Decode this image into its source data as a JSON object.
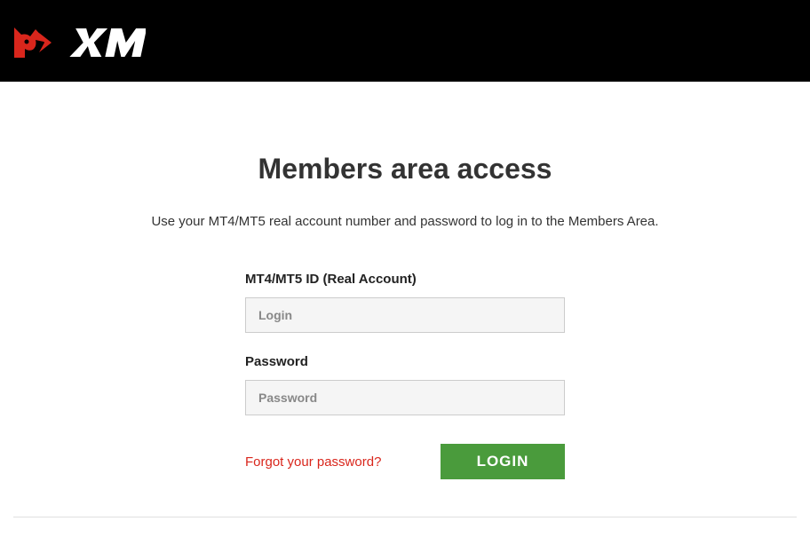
{
  "header": {
    "brand": "XM"
  },
  "page": {
    "title": "Members area access",
    "subtitle": "Use your MT4/MT5 real account number and password to log in to the Members Area."
  },
  "form": {
    "id_label": "MT4/MT5 ID (Real Account)",
    "id_placeholder": "Login",
    "id_value": "",
    "password_label": "Password",
    "password_placeholder": "Password",
    "password_value": "",
    "forgot_link": "Forgot your password?",
    "login_button": "LOGIN"
  },
  "colors": {
    "accent_red": "#d9261c",
    "button_green": "#4a9b3c"
  }
}
